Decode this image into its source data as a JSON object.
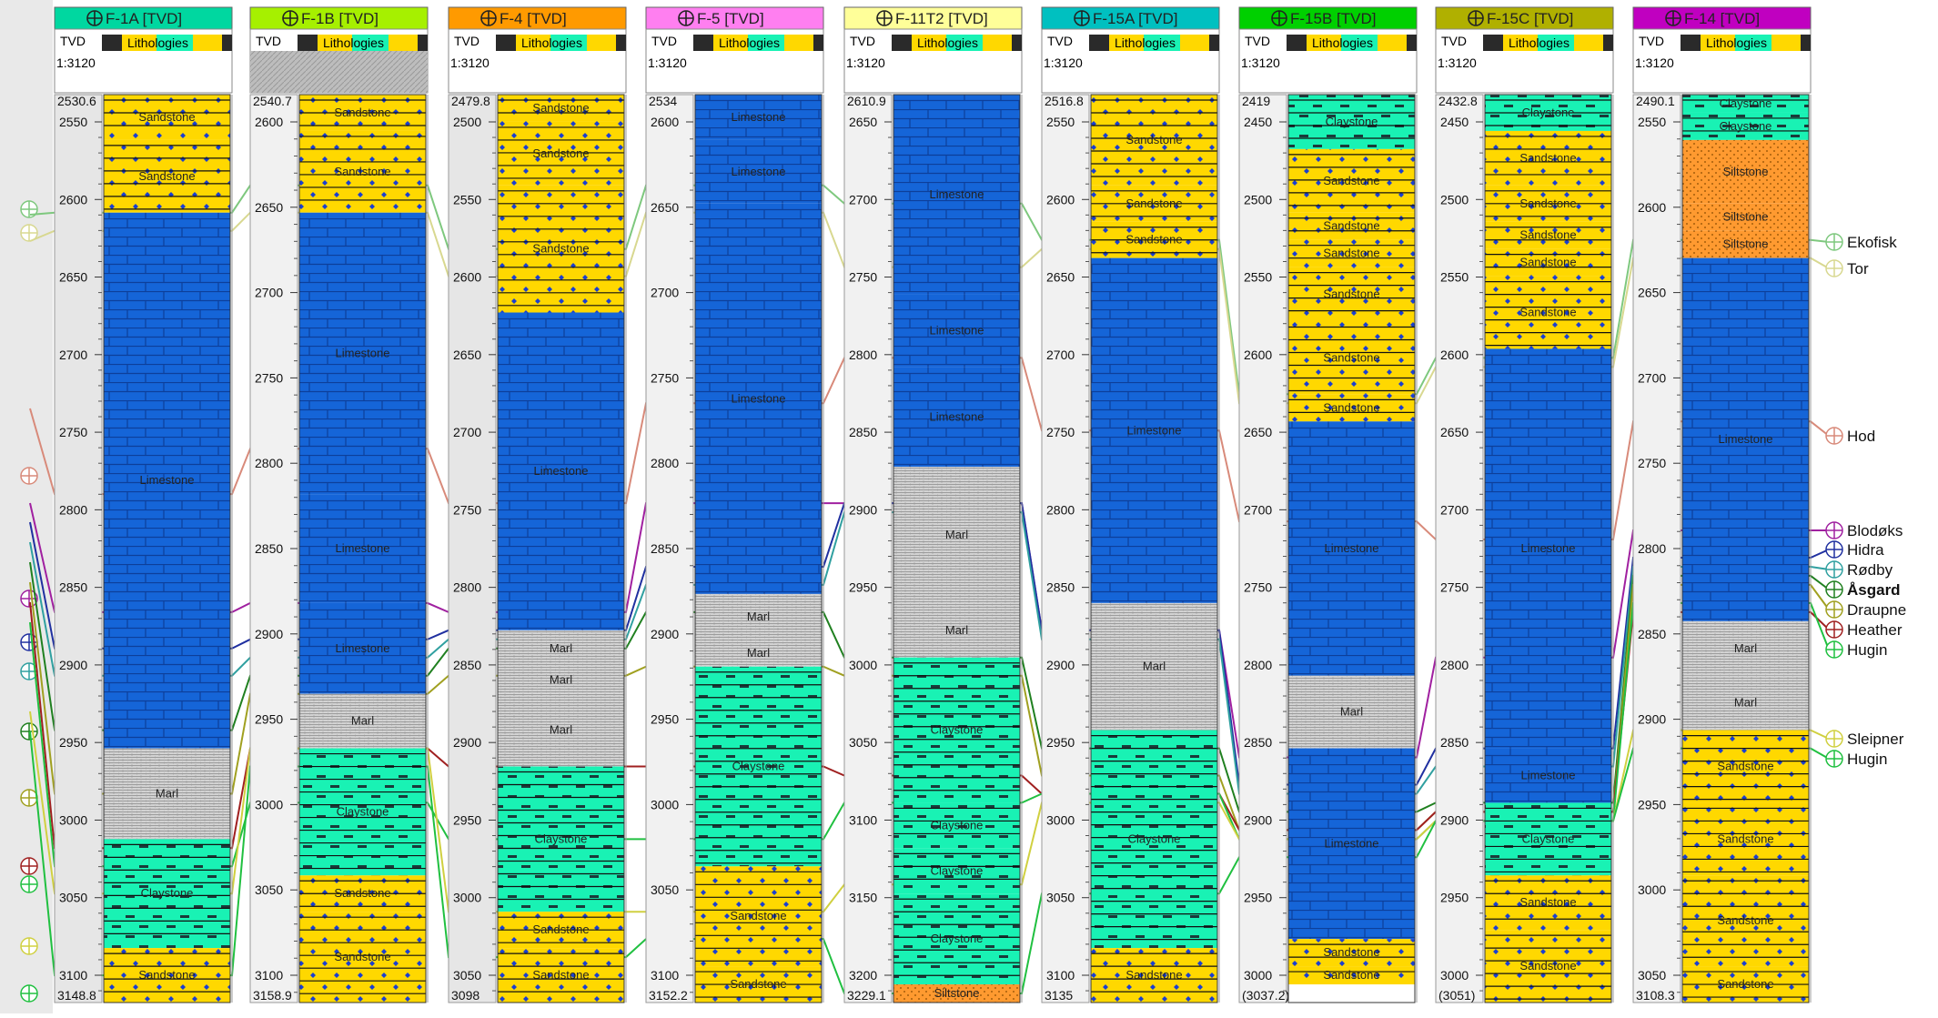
{
  "window": {
    "scale": "1:3120",
    "track_tvd": "TVD",
    "track_lith": "Lithologies"
  },
  "wells": [
    {
      "name": "F-1A [TVD]",
      "color": "#00d7a0",
      "top": "2530.6",
      "bottom": "3148.8",
      "ticks": [
        "2550",
        "2600",
        "2650",
        "2700",
        "2750",
        "2800",
        "2850",
        "2900",
        "2950",
        "3000",
        "3050",
        "3100"
      ],
      "tvd_grey": true,
      "units": [
        [
          "Sandstone",
          0,
          0.05
        ],
        [
          "Sandstone",
          0.05,
          0.13
        ],
        [
          "Limestone",
          0.13,
          0.72
        ],
        [
          "Marl",
          0.72,
          0.82
        ],
        [
          "Claystone",
          0.82,
          0.94
        ],
        [
          "Sandstone",
          0.94,
          1.0
        ]
      ]
    },
    {
      "name": "F-1B [TVD]",
      "color": "#a6f000",
      "top": "2540.7",
      "bottom": "3158.9",
      "ticks": [
        "2600",
        "2650",
        "2700",
        "2750",
        "2800",
        "2850",
        "2900",
        "2950",
        "3000",
        "3050",
        "3100"
      ],
      "tvd_grey": false,
      "units": [
        [
          "Sandstone",
          0,
          0.04
        ],
        [
          "Sandstone",
          0.04,
          0.13
        ],
        [
          "Limestone",
          0.13,
          0.44
        ],
        [
          "Limestone",
          0.44,
          0.56
        ],
        [
          "Limestone",
          0.56,
          0.66
        ],
        [
          "Marl",
          0.66,
          0.72
        ],
        [
          "Claystone",
          0.72,
          0.86
        ],
        [
          "Sandstone",
          0.86,
          0.9
        ],
        [
          "Sandstone",
          0.9,
          1.0
        ]
      ]
    },
    {
      "name": "F-4 [TVD]",
      "color": "#ff9a00",
      "top": "2479.8",
      "bottom": "3098",
      "ticks": [
        "2500",
        "2550",
        "2600",
        "2650",
        "2700",
        "2750",
        "2800",
        "2850",
        "2900",
        "2950",
        "3000",
        "3050"
      ],
      "tvd_grey": true,
      "units": [
        [
          "Sandstone",
          0,
          0.03
        ],
        [
          "Sandstone",
          0.03,
          0.1
        ],
        [
          "Sandstone",
          0.1,
          0.24
        ],
        [
          "Limestone",
          0.24,
          0.59
        ],
        [
          "Marl",
          0.59,
          0.63
        ],
        [
          "Marl",
          0.63,
          0.66
        ],
        [
          "Marl",
          0.66,
          0.74
        ],
        [
          "Claystone",
          0.74,
          0.9
        ],
        [
          "Sandstone",
          0.9,
          0.94
        ],
        [
          "Sandstone",
          0.94,
          1.0
        ]
      ]
    },
    {
      "name": "F-5 [TVD]",
      "color": "#ff7ff0",
      "top": "2534",
      "bottom": "3152.2",
      "ticks": [
        "2600",
        "2650",
        "2700",
        "2750",
        "2800",
        "2850",
        "2900",
        "2950",
        "3000",
        "3050",
        "3100"
      ],
      "tvd_grey": false,
      "units": [
        [
          "Limestone",
          0,
          0.05
        ],
        [
          "Limestone",
          0.05,
          0.12
        ],
        [
          "Limestone",
          0.12,
          0.55
        ],
        [
          "Marl",
          0.55,
          0.6
        ],
        [
          "Marl",
          0.6,
          0.63
        ],
        [
          "Claystone",
          0.63,
          0.85
        ],
        [
          "Sandstone",
          0.85,
          0.96
        ],
        [
          "Sandstone",
          0.96,
          1.0
        ]
      ]
    },
    {
      "name": "F-11T2 [TVD]",
      "color": "#ffff99",
      "top": "2610.9",
      "bottom": "3229.1",
      "ticks": [
        "2650",
        "2700",
        "2750",
        "2800",
        "2850",
        "2900",
        "2950",
        "3000",
        "3050",
        "3100",
        "3150",
        "3200"
      ],
      "tvd_grey": false,
      "units": [
        [
          "Limestone",
          0,
          0.22
        ],
        [
          "Limestone",
          0.22,
          0.3
        ],
        [
          "Limestone",
          0.3,
          0.41
        ],
        [
          "Marl",
          0.41,
          0.56
        ],
        [
          "Marl",
          0.56,
          0.62
        ],
        [
          "Claystone",
          0.62,
          0.78
        ],
        [
          "Claystone",
          0.78,
          0.83
        ],
        [
          "Claystone",
          0.83,
          0.88
        ],
        [
          "Claystone",
          0.88,
          0.98
        ],
        [
          "Siltstone",
          0.98,
          1.0
        ]
      ]
    },
    {
      "name": "F-15A [TVD]",
      "color": "#00c0c0",
      "top": "2516.8",
      "bottom": "3135",
      "ticks": [
        "2550",
        "2600",
        "2650",
        "2700",
        "2750",
        "2800",
        "2850",
        "2900",
        "2950",
        "3000",
        "3050",
        "3100"
      ],
      "tvd_grey": false,
      "units": [
        [
          "Sandstone",
          0,
          0.1
        ],
        [
          "Sandstone",
          0.1,
          0.14
        ],
        [
          "Sandstone",
          0.14,
          0.18
        ],
        [
          "Limestone",
          0.18,
          0.56
        ],
        [
          "Marl",
          0.56,
          0.7
        ],
        [
          "Claystone",
          0.7,
          0.94
        ],
        [
          "Sandstone",
          0.94,
          1.0
        ]
      ]
    },
    {
      "name": "F-15B [TVD]",
      "color": "#00d000",
      "top": "2419",
      "bottom": "(3037.2)",
      "ticks": [
        "2450",
        "2500",
        "2550",
        "2600",
        "2650",
        "2700",
        "2750",
        "2800",
        "2850",
        "2900",
        "2950",
        "3000"
      ],
      "tvd_grey": false,
      "units": [
        [
          "Claystone",
          0,
          0.06
        ],
        [
          "Sandstone",
          0.06,
          0.13
        ],
        [
          "Sandstone",
          0.13,
          0.16
        ],
        [
          "Sandstone",
          0.16,
          0.19
        ],
        [
          "Sandstone",
          0.19,
          0.25
        ],
        [
          "Sandstone",
          0.25,
          0.33
        ],
        [
          "Sandstone",
          0.33,
          0.36
        ],
        [
          "Limestone",
          0.36,
          0.64
        ],
        [
          "Marl",
          0.64,
          0.72
        ],
        [
          "Limestone",
          0.72,
          0.93
        ],
        [
          "Sandstone",
          0.93,
          0.96
        ],
        [
          "Sandstone",
          0.96,
          0.98
        ]
      ]
    },
    {
      "name": "F-15C [TVD]",
      "color": "#b0b000",
      "top": "2432.8",
      "bottom": "(3051)",
      "ticks": [
        "2450",
        "2500",
        "2550",
        "2600",
        "2650",
        "2700",
        "2750",
        "2800",
        "2850",
        "2900",
        "2950",
        "3000"
      ],
      "tvd_grey": false,
      "units": [
        [
          "Claystone",
          0,
          0.04
        ],
        [
          "Sandstone",
          0.04,
          0.1
        ],
        [
          "Sandstone",
          0.1,
          0.14
        ],
        [
          "Sandstone",
          0.14,
          0.17
        ],
        [
          "Sandstone",
          0.17,
          0.2
        ],
        [
          "Sandstone",
          0.2,
          0.28
        ],
        [
          "Limestone",
          0.28,
          0.72
        ],
        [
          "Limestone",
          0.72,
          0.78
        ],
        [
          "Claystone",
          0.78,
          0.86
        ],
        [
          "Sandstone",
          0.86,
          0.92
        ],
        [
          "Sandstone",
          0.92,
          1.0
        ]
      ]
    },
    {
      "name": "F-14 [TVD]",
      "color": "#c000c0",
      "top": "2490.1",
      "bottom": "3108.3",
      "ticks": [
        "2550",
        "2600",
        "2650",
        "2700",
        "2750",
        "2800",
        "2850",
        "2900",
        "2950",
        "3000",
        "3050"
      ],
      "tvd_grey": false,
      "units": [
        [
          "Claystone",
          0,
          0.02
        ],
        [
          "Claystone",
          0.02,
          0.05
        ],
        [
          "Siltstone",
          0.05,
          0.12
        ],
        [
          "Siltstone",
          0.12,
          0.15
        ],
        [
          "Siltstone",
          0.15,
          0.18
        ],
        [
          "Limestone",
          0.18,
          0.58
        ],
        [
          "Marl",
          0.58,
          0.64
        ],
        [
          "Marl",
          0.64,
          0.7
        ],
        [
          "Sandstone",
          0.7,
          0.78
        ],
        [
          "Sandstone",
          0.78,
          0.86
        ],
        [
          "Sandstone",
          0.86,
          0.96
        ],
        [
          "Sandstone",
          0.96,
          1.0
        ]
      ]
    }
  ],
  "legend": [
    {
      "label": "Ekofisk",
      "color": "#7ec87e"
    },
    {
      "label": "Tor",
      "color": "#d8d890"
    },
    {
      "label": "Hod",
      "color": "#d88a7a"
    },
    {
      "label": "Blodøks",
      "color": "#a020a0"
    },
    {
      "label": "Hidra",
      "color": "#2030a0"
    },
    {
      "label": "Rødby",
      "color": "#30a0a0"
    },
    {
      "label": "Åsgard",
      "color": "#208020"
    },
    {
      "label": "Draupne",
      "color": "#a0a020"
    },
    {
      "label": "Heather",
      "color": "#a02020"
    },
    {
      "label": "Hugin",
      "color": "#20c040"
    },
    {
      "label": "Sleipner",
      "color": "#d0d040"
    },
    {
      "label": "Hugin",
      "color": "#20c040"
    }
  ],
  "marker_tags": [
    "Hod",
    "Tor",
    "Ekofisk",
    "Blodøks",
    "Hidra",
    "Åsgard",
    "Heather"
  ]
}
